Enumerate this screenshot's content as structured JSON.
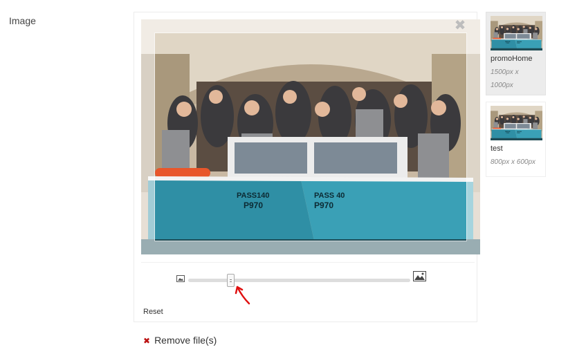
{
  "field": {
    "label": "Image"
  },
  "cropper": {
    "close_glyph": "✖",
    "zoom_level": 0.19
  },
  "zoom": {
    "small_icon": "image-small-icon",
    "large_icon": "image-large-icon",
    "reset_label": "Reset"
  },
  "remove": {
    "glyph": "✖",
    "label": "Remove file(s)"
  },
  "thumbnails": [
    {
      "name": "promoHome",
      "dims": "1500px x 1000px",
      "selected": true
    },
    {
      "name": "test",
      "dims": "800px x 600px",
      "selected": false
    }
  ],
  "colors": {
    "remove_x": "#b11111",
    "annotation_arrow": "#e01010",
    "selected_thumb": "#ececec"
  }
}
